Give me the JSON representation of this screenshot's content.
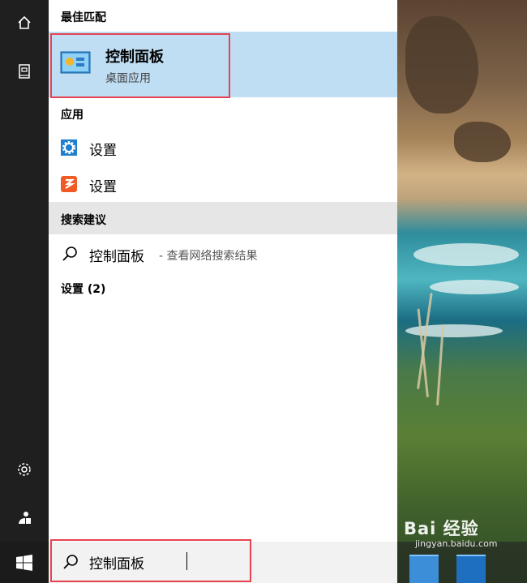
{
  "rail": {
    "icons": [
      "home-icon",
      "documents-icon",
      "settings-icon",
      "user-icon"
    ]
  },
  "panel": {
    "best_match_header": "最佳匹配",
    "best_match": {
      "title": "控制面板",
      "subtitle": "桌面应用",
      "icon": "control-panel-icon"
    },
    "apps_header": "应用",
    "apps": [
      {
        "label": "设置",
        "icon": "settings-gear-icon"
      },
      {
        "label": "设置",
        "icon": "sogou-settings-icon"
      }
    ],
    "suggest_header": "搜索建议",
    "suggestion": {
      "main": "控制面板",
      "sub": "- 查看网络搜索结果",
      "icon": "search-icon"
    },
    "settings_header": "设置 (2)"
  },
  "taskbar": {
    "search_text": "控制面板",
    "search_icon": "search-icon",
    "start_icon": "windows-logo-icon"
  },
  "watermark": {
    "main": "Bai 经验",
    "sub": "jingyan.baidu.com"
  },
  "colors": {
    "highlight": "#bfdef3",
    "outline": "#e64350",
    "rail": "#1f1f1f"
  }
}
